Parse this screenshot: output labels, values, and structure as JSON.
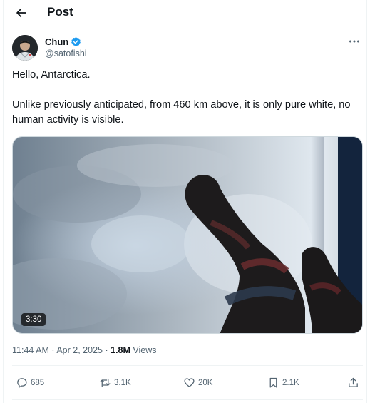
{
  "header": {
    "title": "Post",
    "back_icon": "arrow-left-icon"
  },
  "author": {
    "name": "Chun",
    "handle": "@satofishi",
    "verified": true,
    "verified_color": "#1d9bf0",
    "more_icon": "more-horizontal-icon"
  },
  "tweet": {
    "lines": [
      "Hello, Antarctica.",
      "Unlike previously anticipated, from 460 km above, it is only pure white, no human activity is visible."
    ]
  },
  "media": {
    "type": "video",
    "duration": "3:30"
  },
  "meta": {
    "time": "11:44 AM",
    "separator": "·",
    "date": "Apr 2, 2025",
    "views_count": "1.8M",
    "views_label": "Views"
  },
  "actions": {
    "replies": {
      "icon": "reply-icon",
      "count": "685"
    },
    "reposts": {
      "icon": "repost-icon",
      "count": "3.1K"
    },
    "likes": {
      "icon": "like-icon",
      "count": "20K"
    },
    "bookmarks": {
      "icon": "bookmark-icon",
      "count": "2.1K"
    },
    "share": {
      "icon": "share-icon"
    }
  },
  "colors": {
    "text": "#0f1419",
    "secondary": "#536471",
    "border": "#eff3f4",
    "accent": "#1d9bf0"
  }
}
